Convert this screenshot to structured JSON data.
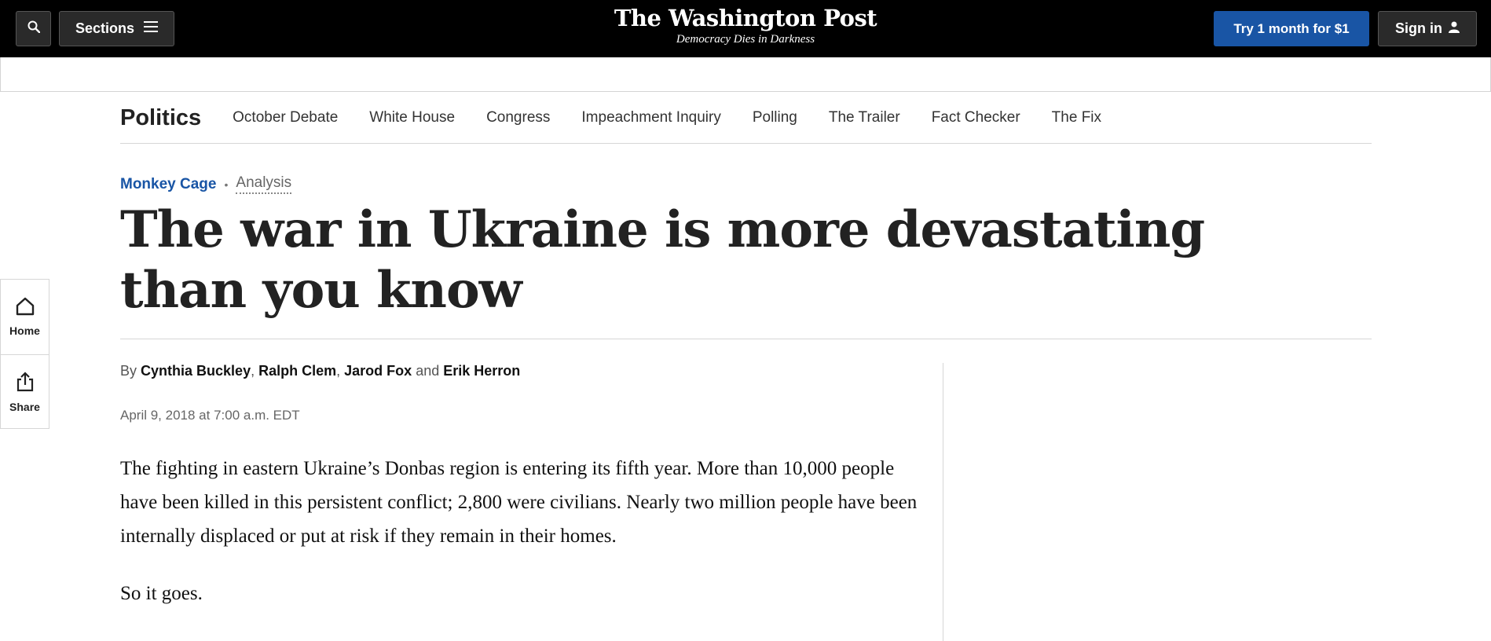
{
  "header": {
    "sections_label": "Sections",
    "logo_text": "The Washington Post",
    "tagline": "Democracy Dies in Darkness",
    "subscribe_label": "Try 1 month for $1",
    "signin_label": "Sign in"
  },
  "section_nav": {
    "title": "Politics",
    "items": [
      {
        "label": "October Debate"
      },
      {
        "label": "White House"
      },
      {
        "label": "Congress"
      },
      {
        "label": "Impeachment Inquiry"
      },
      {
        "label": "Polling"
      },
      {
        "label": "The Trailer"
      },
      {
        "label": "Fact Checker"
      },
      {
        "label": "The Fix"
      }
    ]
  },
  "siderail": {
    "home_label": "Home",
    "share_label": "Share"
  },
  "article": {
    "kicker_column": "Monkey Cage",
    "kicker_label": "Analysis",
    "headline": "The war in Ukraine is more devastating than you know",
    "byline_prefix": "By",
    "authors": [
      "Cynthia Buckley",
      "Ralph Clem",
      "Jarod Fox",
      "Erik Herron"
    ],
    "byline_and": "and",
    "date": "April 9, 2018 at 7:00 a.m. EDT",
    "paragraphs": [
      "The fighting in eastern Ukraine’s Donbas region is entering its fifth year. More than 10,000 people have been killed in this persistent conflict; 2,800 were civilians. Nearly two million people have been internally displaced or put at risk if they remain in their homes.",
      "So it goes."
    ]
  },
  "icons": {
    "search": "search-icon",
    "menu": "hamburger-icon",
    "user": "user-icon",
    "home": "home-icon",
    "share": "share-icon"
  },
  "colors": {
    "header_bg": "#000000",
    "accent_blue": "#1955a5"
  }
}
